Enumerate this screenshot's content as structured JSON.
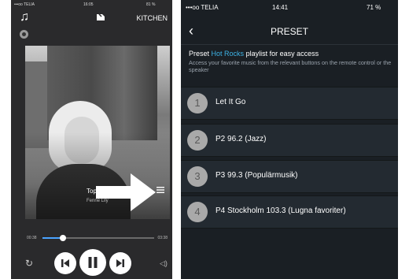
{
  "left_phone": {
    "status": {
      "carrier": "•••oo TELIA",
      "time": "16:05",
      "battery": "81 %"
    },
    "room": "KITCHEN",
    "song": {
      "title": "Top",
      "artist": "Fenne Lily"
    },
    "time_elapsed": "00:38",
    "time_total": "03:38",
    "progress": 0.18
  },
  "right_phone": {
    "status": {
      "carrier": "•••oo TELIA",
      "time": "14:41",
      "battery": "71 %"
    },
    "title": "PRESET",
    "header": {
      "pre": "Preset",
      "highlight": "Hot Rocks",
      "post": "playlist for easy access"
    },
    "subtitle": "Access your favorite music from the relevant buttons on the remote control or the speaker",
    "presets": [
      {
        "num": "1",
        "label": "Let It Go"
      },
      {
        "num": "2",
        "label": "P2 96.2 (Jazz)"
      },
      {
        "num": "3",
        "label": "P3 99.3 (Populärmusik)"
      },
      {
        "num": "4",
        "label": "P4 Stockholm 103.3 (Lugna favoriter)"
      }
    ]
  },
  "colors": {
    "accent": "#3db3e6",
    "progress": "#4aa3ff"
  }
}
